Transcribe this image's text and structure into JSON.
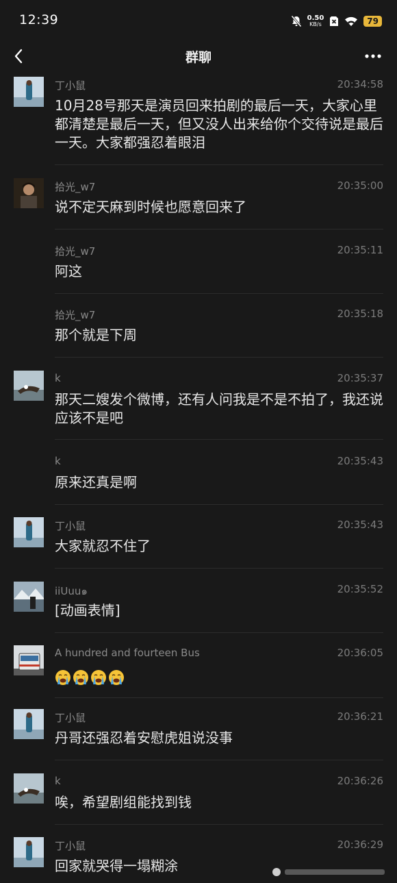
{
  "status_bar": {
    "time": "12:39",
    "net_speed_value": "0.50",
    "net_speed_unit": "KB/s",
    "battery": "79"
  },
  "nav": {
    "title": "群聊"
  },
  "messages": [
    {
      "sender": "丁小鼠",
      "time": "20:34:58",
      "text": "10月28号那天是演员回来拍剧的最后一天，大家心里都清楚是最后一天，但又没人出来给你个交待说是最后一天。大家都强忍着眼泪"
    },
    {
      "sender": "拾光_w7",
      "time": "20:35:00",
      "text": "说不定天麻到时候也愿意回来了"
    },
    {
      "sender": "拾光_w7",
      "time": "20:35:11",
      "text": "阿这"
    },
    {
      "sender": "拾光_w7",
      "time": "20:35:18",
      "text": "那个就是下周"
    },
    {
      "sender": "k",
      "time": "20:35:37",
      "text": "那天二嫂发个微博，还有人问我是不是不拍了，我还说应该不是吧"
    },
    {
      "sender": "k",
      "time": "20:35:43",
      "text": "原来还真是啊"
    },
    {
      "sender": "丁小鼠",
      "time": "20:35:43",
      "text": "大家就忍不住了"
    },
    {
      "sender": "iiUuu๑",
      "time": "20:35:52",
      "text": "[动画表情]"
    },
    {
      "sender": "A hundred and fourteen Bus",
      "time": "20:36:05",
      "emoji": "loudly-crying-face",
      "emoji_count": 4
    },
    {
      "sender": "丁小鼠",
      "time": "20:36:21",
      "text": "丹哥还强忍着安慰虎姐说没事"
    },
    {
      "sender": "k",
      "time": "20:36:26",
      "text": "唉，希望剧组能找到钱"
    },
    {
      "sender": "丁小鼠",
      "time": "20:36:29",
      "text": "回家就哭得一塌糊涂"
    }
  ]
}
